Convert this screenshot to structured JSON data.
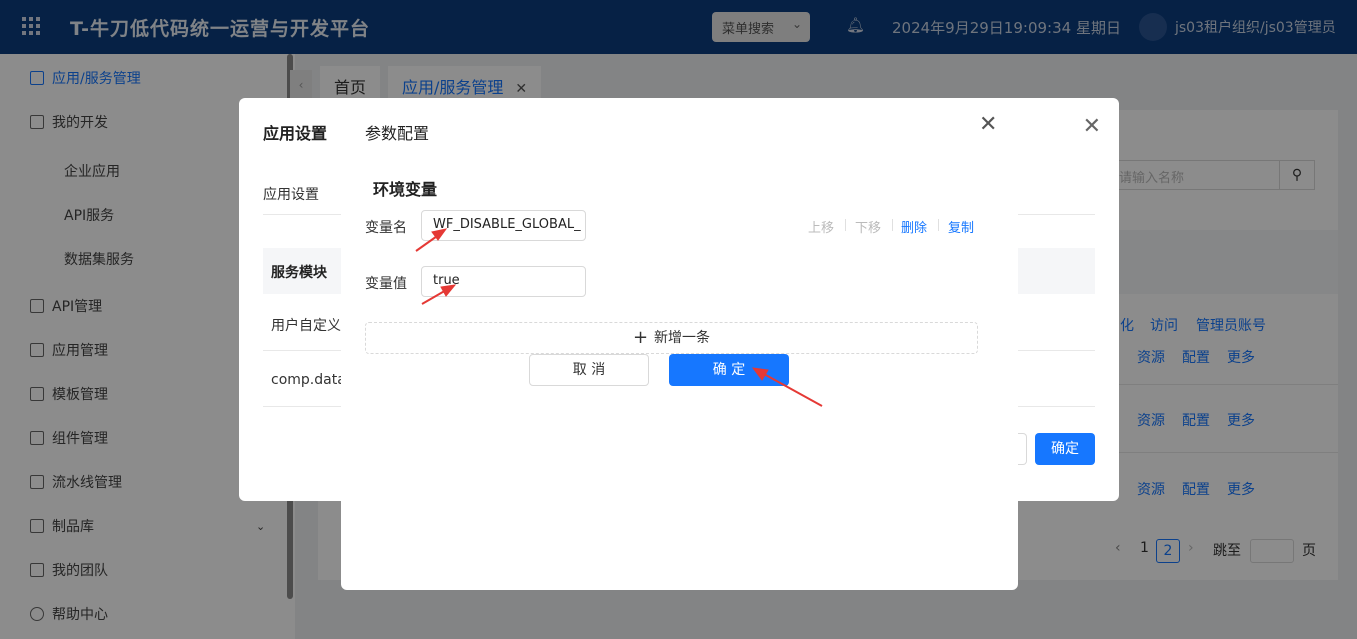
{
  "header": {
    "app_title": "T-牛刀低代码统一运营与开发平台",
    "menu_search": "菜单搜索",
    "datetime": "2024年9月29日19:09:34 星期日",
    "user": "js03租户组织/js03管理员"
  },
  "sidebar": {
    "items": [
      {
        "label": "应用/服务管理"
      },
      {
        "label": "我的开发"
      },
      {
        "label": "企业应用"
      },
      {
        "label": "API服务"
      },
      {
        "label": "数据集服务"
      },
      {
        "label": "API管理"
      },
      {
        "label": "应用管理"
      },
      {
        "label": "模板管理"
      },
      {
        "label": "组件管理"
      },
      {
        "label": "流水线管理"
      },
      {
        "label": "制品库"
      },
      {
        "label": "我的团队"
      },
      {
        "label": "帮助中心"
      }
    ]
  },
  "tabs": {
    "home": "首页",
    "app": "应用/服务管理"
  },
  "list_page": {
    "search_placeholder": "请输入名称",
    "row1_links": [
      "化",
      "访问",
      "管理员账号"
    ],
    "row_links": [
      "资源",
      "配置",
      "更多"
    ],
    "pager": {
      "page1": "1",
      "page2": "2",
      "goto": "跳至",
      "unit": "页"
    }
  },
  "app_dialog": {
    "title": "应用设置",
    "section": "应用设置",
    "col_header": "服务模块",
    "row1": "用户自定义",
    "row2": "comp.datab",
    "ok": "确定"
  },
  "param_dialog": {
    "title": "参数配置",
    "env_title": "环境变量",
    "var_name_label": "变量名",
    "var_name_value": "WF_DISABLE_GLOBAL_",
    "var_value_label": "变量值",
    "var_value_value": "true",
    "actions": {
      "up": "上移",
      "down": "下移",
      "delete": "删除",
      "copy": "复制"
    },
    "add_row": "新增一条",
    "cancel": "取 消",
    "ok": "确 定"
  },
  "colors": {
    "primary": "#1677ff",
    "header_bg": "#0b3d7e",
    "annotation_arrow": "#e53935"
  }
}
